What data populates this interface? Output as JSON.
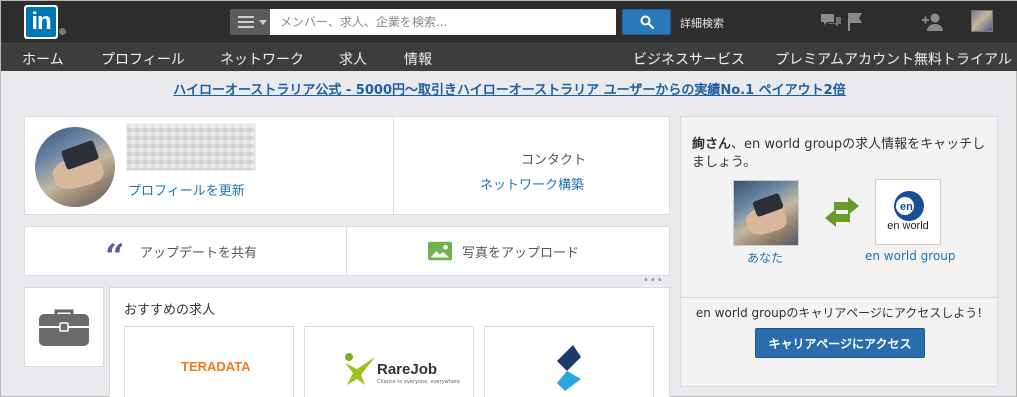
{
  "topbar": {
    "logo_text": "in",
    "search_placeholder": "メンバー、求人、企業を検索...",
    "advanced_search": "詳細検索"
  },
  "nav": {
    "items": [
      "ホーム",
      "プロフィール",
      "ネットワーク",
      "求人",
      "情報"
    ],
    "right_items": [
      "ビジネスサービス",
      "プレミアムアカウント無料トライアル"
    ]
  },
  "ad": {
    "text": "ハイローオーストラリア公式 - 5000円〜取引きハイローオーストラリア ユーザーからの実績No.1 ペイアウト2倍"
  },
  "profile": {
    "update_link": "プロフィールを更新",
    "contacts_label": "コンタクト",
    "network_link": "ネットワーク構築"
  },
  "share": {
    "update_label": "アップデートを共有",
    "photo_label": "写真をアップロード"
  },
  "jobs": {
    "title": "おすすめの求人",
    "companies": [
      {
        "name": "TERADATA"
      },
      {
        "name": "RareJob",
        "tagline": "Chance to everyone, everywhere"
      },
      {
        "name": ""
      }
    ]
  },
  "promo": {
    "heading_name": "絢さん",
    "heading_rest": "、en world groupの求人情報をキャッチしましょう。",
    "you_label": "あなた",
    "company_label": "en world group",
    "logo_text": "en world",
    "access_text": "en world groupのキャリアページにアクセスしよう!",
    "button_label": "キャリアページにアクセス"
  },
  "colors": {
    "topbar": "#2d2d2d",
    "navbar": "#3d3d3d",
    "linkedin_blue": "#0077b5",
    "link": "#1d74b3",
    "accent_button": "#2b6cad"
  },
  "icons": [
    "menu-icon",
    "search-icon",
    "messages-icon",
    "flag-icon",
    "add-connection-icon",
    "quote-icon",
    "photo-icon",
    "briefcase-icon",
    "swap-arrows-icon"
  ]
}
